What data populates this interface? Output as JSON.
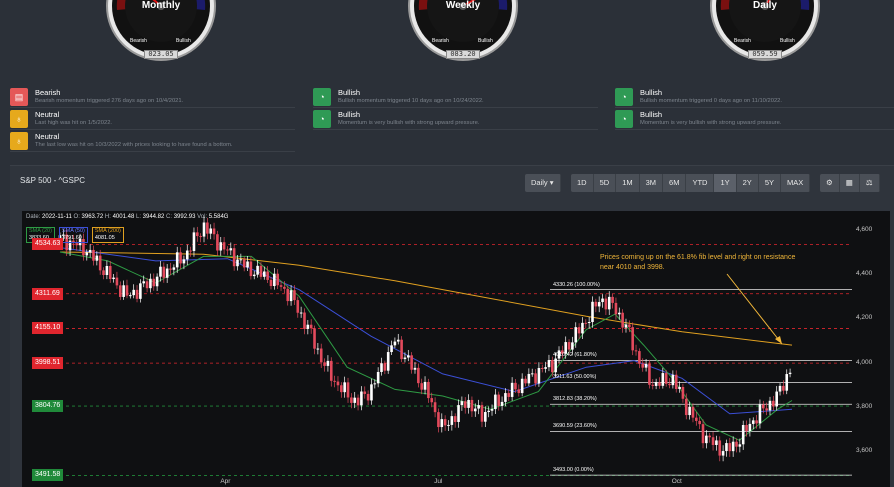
{
  "gauges": [
    {
      "title": "Monthly",
      "bear": "Bearish",
      "bull": "Bullish",
      "value": "023.05"
    },
    {
      "title": "Weekly",
      "bear": "Bearish",
      "bull": "Bullish",
      "value": "083.20"
    },
    {
      "title": "Daily",
      "bear": "Bearish",
      "bull": "Bullish",
      "value": "059.59"
    }
  ],
  "signals": {
    "monthly": [
      {
        "icon": "chat-bubble-icon",
        "color": "#e45858",
        "title": "Bearish",
        "desc": "Bearish momentum triggered 276 days ago on 10/4/2021."
      },
      {
        "icon": "bulb-icon",
        "color": "#e6a91c",
        "title": "Neutral",
        "desc": "Last high was hit on 1/5/2022."
      },
      {
        "icon": "bulb-icon",
        "color": "#e6a91c",
        "title": "Neutral",
        "desc": "The last low was hit on 10/3/2022 with prices looking to have found a bottom."
      }
    ],
    "weekly": [
      {
        "icon": "gauge-icon",
        "color": "#2f9a55",
        "title": "Bullish",
        "desc": "Bullish momentum triggered 10 days ago on 10/24/2022."
      },
      {
        "icon": "gauge-icon",
        "color": "#2f9a55",
        "title": "Bullish",
        "desc": "Momentum is very bullish with strong upward pressure."
      }
    ],
    "daily": [
      {
        "icon": "gauge-icon",
        "color": "#2f9a55",
        "title": "Bullish",
        "desc": "Bullish momentum triggered 0 days ago on 11/10/2022."
      },
      {
        "icon": "gauge-icon",
        "color": "#2f9a55",
        "title": "Bullish",
        "desc": "Momentum is very bullish with strong upward pressure."
      }
    ]
  },
  "chart_header": {
    "title": "S&P 500 - ^GSPC",
    "interval": "Daily"
  },
  "ranges": [
    "1D",
    "5D",
    "1M",
    "3M",
    "6M",
    "YTD",
    "1Y",
    "2Y",
    "5Y",
    "MAX"
  ],
  "active_range": "1Y",
  "tools": [
    "settings-icon",
    "calculator-icon",
    "scale-icon"
  ],
  "ohlc": {
    "date_label": "Date",
    "date": "2022-11-11",
    "o_label": "O",
    "o": "3963.72",
    "h_label": "H",
    "h": "4001.48",
    "l_label": "L",
    "l": "3944.82",
    "c_label": "C",
    "c": "3992.93",
    "v_label": "Vol",
    "v": "5.584G"
  },
  "sma": [
    {
      "label": "SMA (20)",
      "value": "3833.60",
      "color": "#2e9b44"
    },
    {
      "label": "SMA (50)",
      "value": "3791.60",
      "color": "#3b4fd6"
    },
    {
      "label": "SMA (200)",
      "value": "4081.05",
      "color": "#e0a020"
    }
  ],
  "levels": [
    {
      "value": "4534.63",
      "color": "#e0262e"
    },
    {
      "value": "4311.69",
      "color": "#e0262e"
    },
    {
      "value": "4155.10",
      "color": "#e0262e"
    },
    {
      "value": "3998.51",
      "color": "#e0262e"
    },
    {
      "value": "3804.76",
      "color": "#208a3a"
    },
    {
      "value": "3491.58",
      "color": "#208a3a"
    }
  ],
  "fib": [
    {
      "label": "4330.26 (100.00%)",
      "value": 4330.26
    },
    {
      "label": "4010.42 (61.80%)",
      "value": 4010.42
    },
    {
      "label": "3911.63 (50.00%)",
      "value": 3911.63
    },
    {
      "label": "3812.83 (38.20%)",
      "value": 3812.83
    },
    {
      "label": "3690.59 (23.60%)",
      "value": 3690.59
    },
    {
      "label": "3493.00 (0.00%)",
      "value": 3493.0
    }
  ],
  "annotation": "Prices coming up on the 61.8% fib level and right on resistance near 4010 and 3998.",
  "chart_data": {
    "type": "candlestick",
    "y_ticks": [
      "4,600",
      "4,400",
      "4,200",
      "4,000",
      "3,800",
      "3,600"
    ],
    "x_ticks": [
      "Apr",
      "Jul",
      "Oct"
    ],
    "ylim": [
      3480,
      4640
    ],
    "close_path": [
      [
        0,
        4560
      ],
      [
        10,
        4520
      ],
      [
        20,
        4400
      ],
      [
        28,
        4300
      ],
      [
        40,
        4380
      ],
      [
        52,
        4480
      ],
      [
        60,
        4620
      ],
      [
        68,
        4520
      ],
      [
        78,
        4430
      ],
      [
        88,
        4380
      ],
      [
        96,
        4310
      ],
      [
        104,
        4150
      ],
      [
        110,
        4000
      ],
      [
        116,
        3900
      ],
      [
        124,
        3820
      ],
      [
        130,
        3880
      ],
      [
        140,
        4100
      ],
      [
        146,
        4000
      ],
      [
        154,
        3850
      ],
      [
        160,
        3700
      ],
      [
        170,
        3830
      ],
      [
        176,
        3760
      ],
      [
        186,
        3850
      ],
      [
        196,
        3930
      ],
      [
        206,
        4000
      ],
      [
        216,
        4130
      ],
      [
        226,
        4290
      ],
      [
        232,
        4250
      ],
      [
        238,
        4130
      ],
      [
        242,
        4010
      ],
      [
        248,
        3900
      ],
      [
        256,
        3930
      ],
      [
        262,
        3800
      ],
      [
        270,
        3660
      ],
      [
        278,
        3600
      ],
      [
        284,
        3650
      ],
      [
        288,
        3720
      ],
      [
        294,
        3790
      ],
      [
        300,
        3850
      ],
      [
        306,
        3990
      ]
    ],
    "sma20": [
      [
        0,
        4500
      ],
      [
        20,
        4460
      ],
      [
        40,
        4360
      ],
      [
        60,
        4480
      ],
      [
        80,
        4480
      ],
      [
        100,
        4300
      ],
      [
        120,
        3980
      ],
      [
        140,
        3880
      ],
      [
        160,
        3850
      ],
      [
        180,
        3790
      ],
      [
        200,
        3870
      ],
      [
        220,
        4150
      ],
      [
        232,
        4220
      ],
      [
        244,
        4080
      ],
      [
        256,
        3930
      ],
      [
        270,
        3720
      ],
      [
        284,
        3650
      ],
      [
        300,
        3790
      ],
      [
        306,
        3830
      ]
    ],
    "sma50": [
      [
        0,
        4520
      ],
      [
        40,
        4460
      ],
      [
        70,
        4470
      ],
      [
        100,
        4330
      ],
      [
        130,
        4120
      ],
      [
        160,
        3950
      ],
      [
        190,
        3870
      ],
      [
        220,
        3980
      ],
      [
        240,
        4010
      ],
      [
        260,
        3930
      ],
      [
        280,
        3770
      ],
      [
        306,
        3790
      ]
    ],
    "sma200": [
      [
        0,
        4500
      ],
      [
        60,
        4490
      ],
      [
        100,
        4440
      ],
      [
        140,
        4370
      ],
      [
        180,
        4290
      ],
      [
        220,
        4210
      ],
      [
        260,
        4140
      ],
      [
        306,
        4080
      ]
    ]
  }
}
